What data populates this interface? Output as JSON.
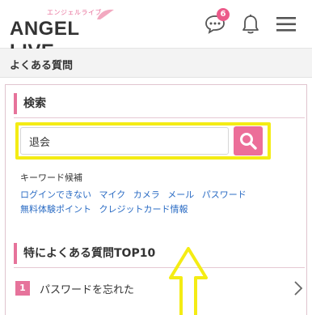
{
  "header": {
    "logo_sub": "エンジェルライブ",
    "logo_main": "ANGEL LIVE",
    "notification_count": "6",
    "icons": [
      "chat-icon",
      "bell-icon",
      "hamburger-menu-icon"
    ]
  },
  "breadcrumb": {
    "title": "よくある質問"
  },
  "search": {
    "section_title": "検索",
    "input_value": "退会",
    "button_icon": "search-icon",
    "keyword_label": "キーワード候補",
    "keywords_row1": [
      "ログインできない",
      "マイク",
      "カメラ",
      "メール",
      "パスワード"
    ],
    "keywords_row2": [
      "無料体験ポイント",
      "クレジットカード情報"
    ]
  },
  "faq": {
    "section_title": "特によくある質問TOP10",
    "items": [
      {
        "rank": "1",
        "text": "パスワードを忘れた"
      }
    ]
  },
  "colors": {
    "accent": "#ec6e99",
    "highlight": "#f4ec14",
    "link": "#2b6cc4"
  }
}
